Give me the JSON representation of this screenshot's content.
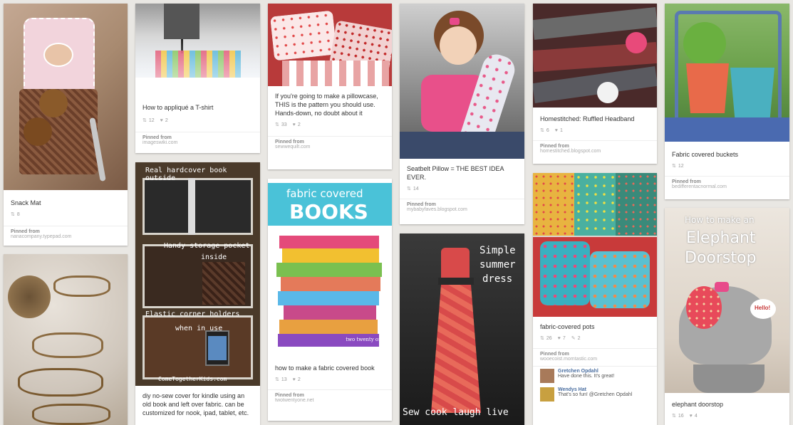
{
  "pins": [
    {
      "id": "snack-mat",
      "title": "Snack Mat",
      "repins": "8",
      "pinned_from_label": "Pinned from",
      "source": "nanacompany.typepad.com"
    },
    {
      "id": "applique",
      "title": "How to appliqué a T-shirt",
      "repins": "12",
      "likes": "2",
      "pinned_from_label": "Pinned from",
      "source": "imageswiki.com"
    },
    {
      "id": "pillowcase",
      "title": "If you're going to make a pillowcase, THIS is the pattern you should use. Hands-down, no doubt about it",
      "repins": "33",
      "likes": "2",
      "pinned_from_label": "Pinned from",
      "source": "sewwequilt.com"
    },
    {
      "id": "seatbelt-pillow",
      "title": "Seatbelt Pillow = THE BEST IDEA EVER.",
      "repins": "14",
      "pinned_from_label": "Pinned from",
      "source": "mybabyfaves.blogspot.com"
    },
    {
      "id": "headband",
      "title": "Homestitched: Ruffled Headband",
      "repins": "6",
      "likes": "1",
      "pinned_from_label": "Pinned from",
      "source": "homestitched.blogspot.com"
    },
    {
      "id": "buckets",
      "title": "Fabric covered buckets",
      "repins": "12",
      "pinned_from_label": "Pinned from",
      "source": "bedifferentacnormal.com"
    },
    {
      "id": "kindle",
      "title": "diy no-sew cover for kindle using an old book and left over fabric. can be customized for nook, ipad, tablet, etc.",
      "overlay_top": "Real hardcover book outside",
      "overlay_mid": "Handy storage pocket",
      "overlay_mid2": "inside",
      "overlay_bot": "Elastic corner holders",
      "overlay_bot2": "when in use",
      "watermark": "ComeTogetherKids.com"
    },
    {
      "id": "books",
      "title": "how to make a fabric covered book",
      "repins": "13",
      "likes": "2",
      "pinned_from_label": "Pinned from",
      "source": "twotwentyone.net",
      "overlay_line1": "fabric covered",
      "overlay_line2": "BOOKS",
      "watermark": "two twenty one."
    },
    {
      "id": "dress",
      "overlay_line1": "Simple",
      "overlay_line2": "summer",
      "overlay_line3": "dress",
      "overlay_bottom": "Sew cook laugh live"
    },
    {
      "id": "pots",
      "title": "fabric-covered pots",
      "repins": "26",
      "likes": "7",
      "comments": "2",
      "pinned_from_label": "Pinned from",
      "source": "wooecoist.momtastic.com"
    },
    {
      "id": "elephant",
      "title": "elephant doorstop",
      "repins": "16",
      "likes": "4",
      "overlay_line1": "How to make an",
      "overlay_line2": "Elephant",
      "overlay_line3": "Doorstop",
      "hello": "Hello!"
    }
  ],
  "comments": [
    {
      "name": "Gretchen Opdahl",
      "text": "Have done this. It's great!"
    },
    {
      "name": "Wendys Hat",
      "text": "That's so fun! @Gretchen Opdahl"
    }
  ],
  "icons": {
    "repin": "repin-icon",
    "like": "heart-icon",
    "comment": "comment-icon"
  },
  "colors": {
    "background": "#e9e7e3",
    "card": "#ffffff",
    "link": "#4a6ea0"
  }
}
